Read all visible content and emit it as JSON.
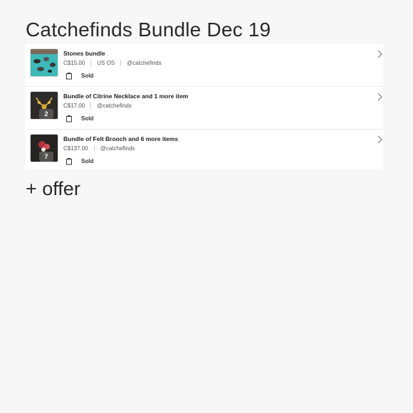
{
  "page": {
    "title": "Catchefinds Bundle Dec 19"
  },
  "bundles": [
    {
      "title": "Stones bundle",
      "price": "C$15.00",
      "size": "US OS",
      "seller": "@catchefinds",
      "status": "Sold",
      "count": ""
    },
    {
      "title": "Bundle of Citrine Necklace and 1 more item",
      "price": "C$17.00",
      "size": "",
      "seller": "@catchefinds",
      "status": "Sold",
      "count": "2"
    },
    {
      "title": "Bundle of Felt Brooch and 6 more items",
      "price": "C$137.00",
      "size": "",
      "seller": "@catchefinds",
      "status": "Sold",
      "count": "7"
    }
  ],
  "actions": {
    "offer_label": "+ offer"
  },
  "icons": {
    "status": "bag-icon",
    "chevron": "chevron-right-icon"
  },
  "colors": {
    "background": "#f7f7f7",
    "card": "#ffffff",
    "thumb_teal": "#3fb8b8"
  }
}
